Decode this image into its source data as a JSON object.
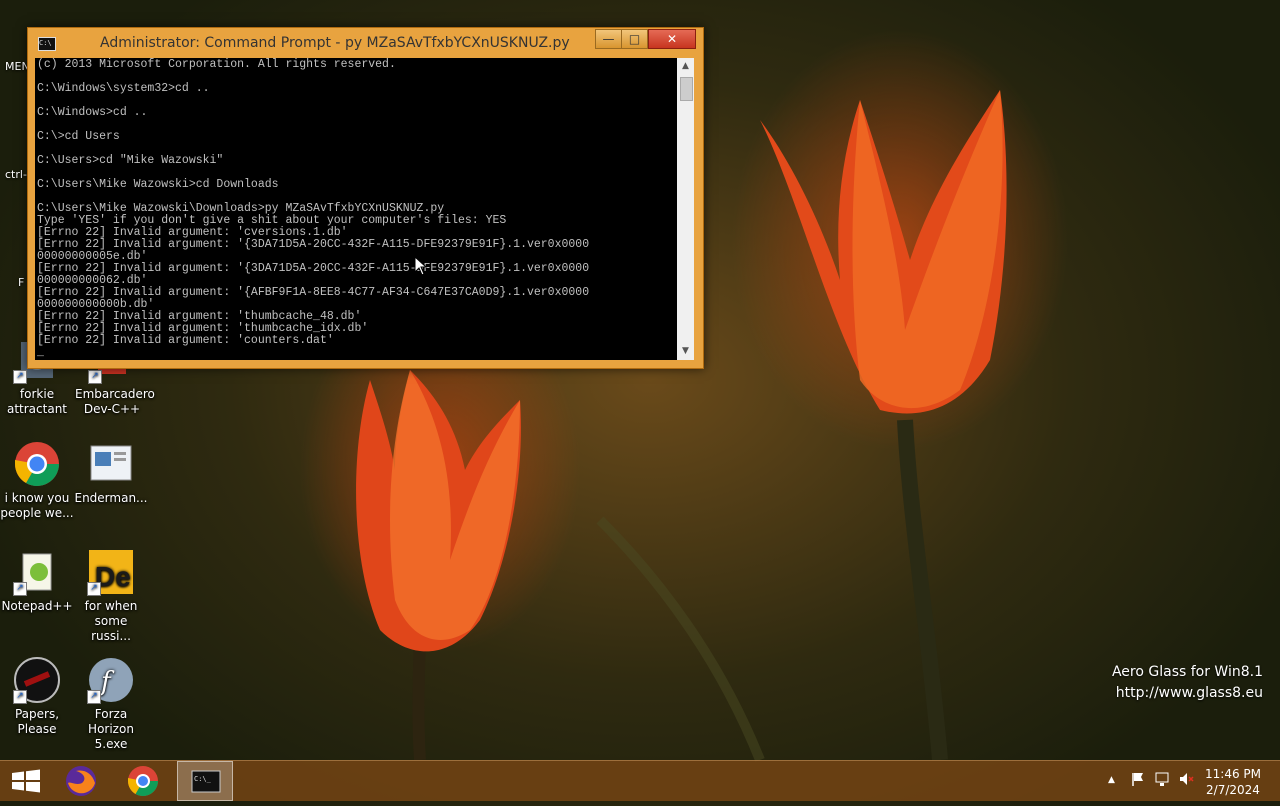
{
  "window": {
    "title": "Administrator: Command Prompt - py  MZaSAvTfxbYCXnUSKNUZ.py",
    "buttons": {
      "minimize": "—",
      "maximize": "□",
      "close": "✕"
    },
    "console_lines": [
      "(c) 2013 Microsoft Corporation. All rights reserved.",
      "",
      "C:\\Windows\\system32>cd ..",
      "",
      "C:\\Windows>cd ..",
      "",
      "C:\\>cd Users",
      "",
      "C:\\Users>cd \"Mike Wazowski\"",
      "",
      "C:\\Users\\Mike Wazowski>cd Downloads",
      "",
      "C:\\Users\\Mike Wazowski\\Downloads>py MZaSAvTfxbYCXnUSKNUZ.py",
      "Type 'YES' if you don't give a shit about your computer's files: YES",
      "[Errno 22] Invalid argument: 'cversions.1.db'",
      "[Errno 22] Invalid argument: '{3DA71D5A-20CC-432F-A115-DFE92379E91F}.1.ver0x0000",
      "00000000005e.db'",
      "[Errno 22] Invalid argument: '{3DA71D5A-20CC-432F-A115-DFE92379E91F}.1.ver0x0000",
      "000000000062.db'",
      "[Errno 22] Invalid argument: '{AFBF9F1A-8EE8-4C77-AF34-C647E37CA0D9}.1.ver0x0000",
      "000000000000b.db'",
      "[Errno 22] Invalid argument: 'thumbcache_48.db'",
      "[Errno 22] Invalid argument: 'thumbcache_idx.db'",
      "[Errno 22] Invalid argument: 'counters.dat'",
      "_"
    ]
  },
  "desktop": {
    "left_partial_labels": [
      "MEN",
      "ctrl-",
      "F"
    ],
    "icons": [
      {
        "id": "forkie",
        "label": "forkie attractant"
      },
      {
        "id": "devcpp",
        "label": "Embarcadero Dev-C++"
      },
      {
        "id": "chrome",
        "label": "i know you people we..."
      },
      {
        "id": "enderman",
        "label": "Enderman..."
      },
      {
        "id": "notepadpp",
        "label": "Notepad++"
      },
      {
        "id": "russian",
        "label": "for when some russi..."
      },
      {
        "id": "papers",
        "label": "Papers, Please"
      },
      {
        "id": "forza",
        "label": "Forza Horizon 5.exe"
      }
    ],
    "watermark": {
      "line1": "Aero Glass for Win8.1",
      "line2": "http://www.glass8.eu"
    }
  },
  "taskbar": {
    "tray": {
      "chevron": "▲",
      "time": "11:46 PM",
      "date": "2/7/2024"
    }
  },
  "colors": {
    "window_frame": "#e8a33f",
    "close_button": "#c7341f",
    "console_bg": "#000000",
    "console_text": "#c0c0c0"
  }
}
